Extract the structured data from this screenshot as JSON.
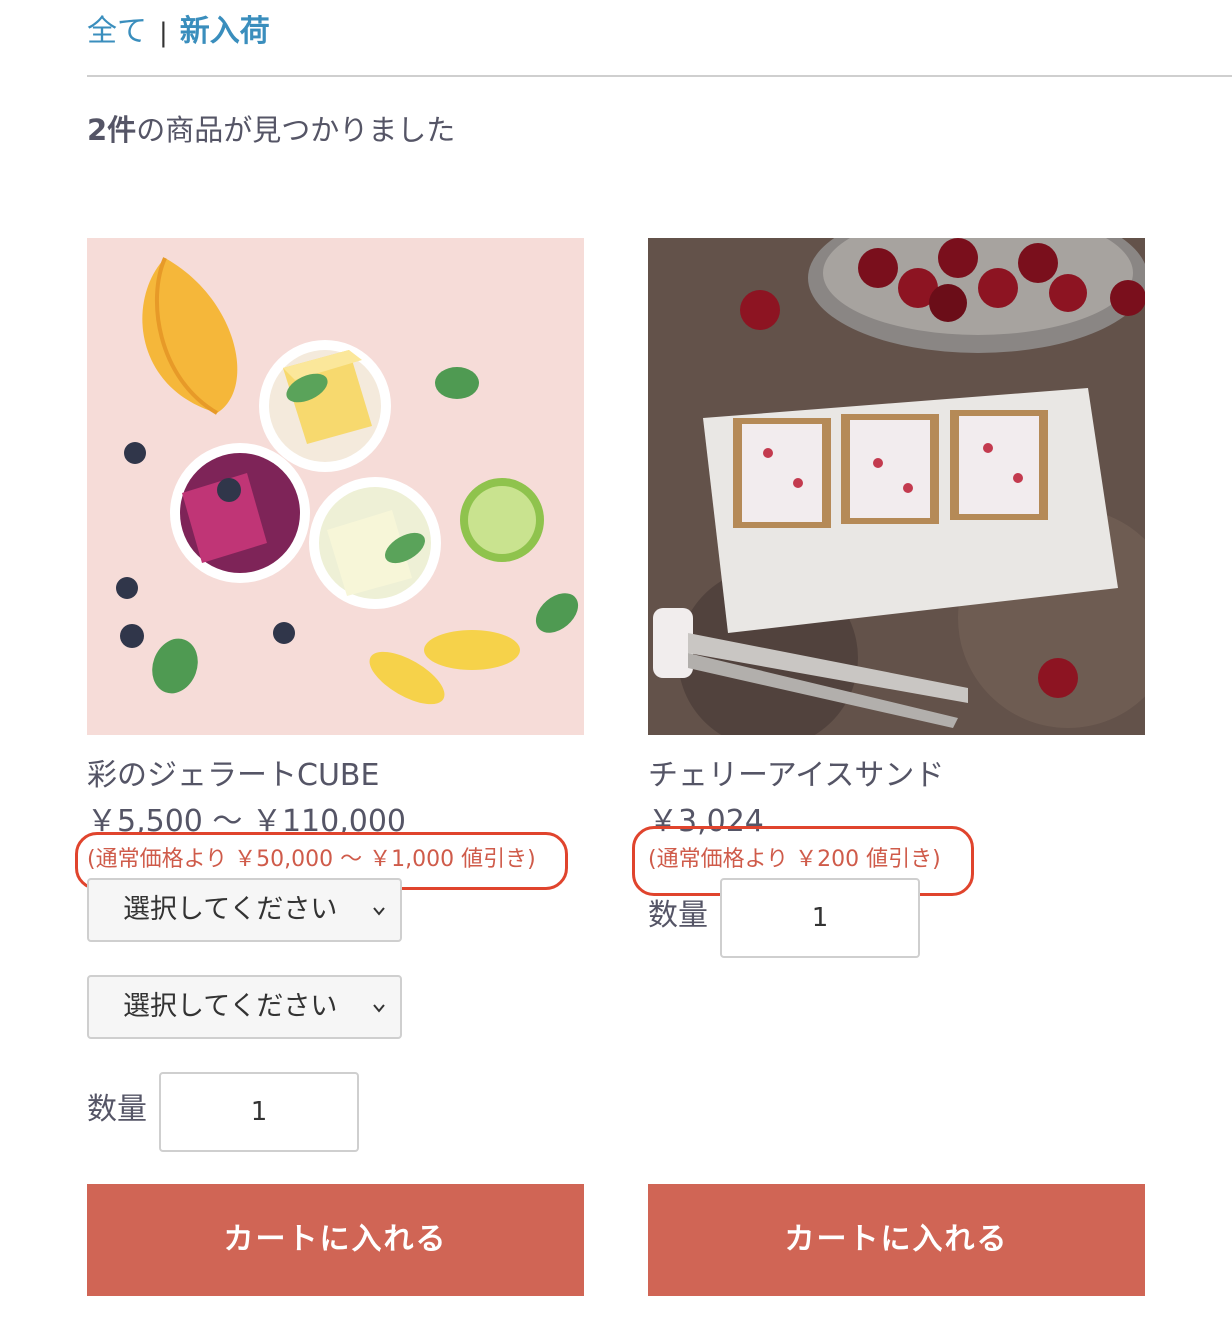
{
  "breadcrumb": {
    "all": "全て",
    "separator": "|",
    "current": "新入荷"
  },
  "result": {
    "count": "2件",
    "text": "の商品が見つかりました"
  },
  "products": [
    {
      "name": "彩のジェラートCUBE",
      "image_icon": "gelato-cubes-image",
      "price": "￥5,500 ～ ￥110,000",
      "discount": "(通常価格より ￥50,000 ～ ￥1,000 値引き)",
      "select1": "選択してください",
      "select2": "選択してください",
      "quantity_label": "数量",
      "quantity": "1",
      "cart_label": "カートに入れる"
    },
    {
      "name": "チェリーアイスサンド",
      "image_icon": "cherry-ice-sandwich-image",
      "price": "￥3,024",
      "discount": "(通常価格より ￥200 値引き)",
      "quantity_label": "数量",
      "quantity": "1",
      "cart_label": "カートに入れる"
    }
  ],
  "colors": {
    "link": "#3a8ebd",
    "discount": "#cf5b4a",
    "annotation": "#e0442d",
    "cart_button": "#d06555"
  }
}
